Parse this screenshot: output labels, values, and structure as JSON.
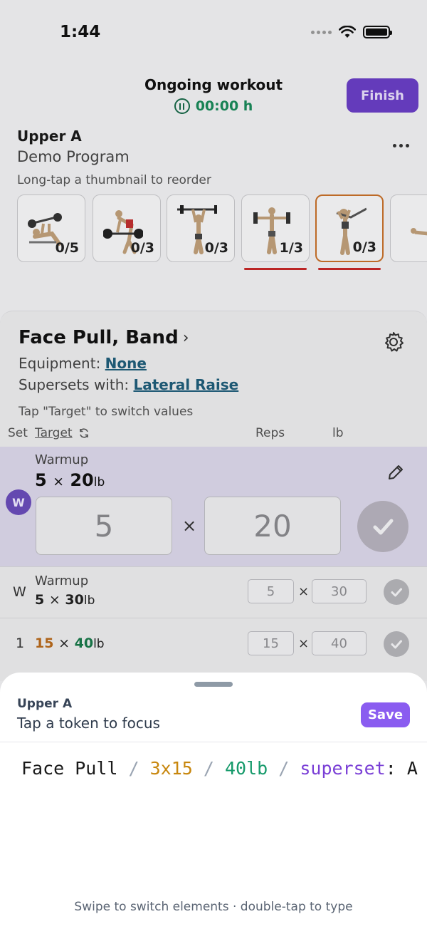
{
  "status": {
    "time": "1:44"
  },
  "header": {
    "title": "Ongoing workout",
    "timer": "00:00 h",
    "finish_label": "Finish"
  },
  "workout": {
    "name": "Upper A",
    "program": "Demo Program",
    "reorder_hint": "Long-tap a thumbnail to reorder"
  },
  "thumbnails": [
    {
      "count": "0/5",
      "active": false,
      "underline": false
    },
    {
      "count": "0/3",
      "active": false,
      "underline": false
    },
    {
      "count": "0/3",
      "active": false,
      "underline": false
    },
    {
      "count": "1/3",
      "active": false,
      "underline": true
    },
    {
      "count": "0/3",
      "active": true,
      "underline": true
    },
    {
      "count": "",
      "active": false,
      "underline": false
    }
  ],
  "exercise": {
    "title": "Face Pull, Band",
    "equipment_label": "Equipment: ",
    "equipment_value": "None",
    "superset_label": "Supersets with: ",
    "superset_value": "Lateral Raise",
    "switch_hint": "Tap \"Target\" to switch values",
    "columns": {
      "set": "Set",
      "target": "Target",
      "reps": "Reps",
      "lb": "lb"
    }
  },
  "active_set": {
    "badge": "W",
    "label": "Warmup",
    "reps": "5",
    "x": "×",
    "weight": "20",
    "unit": "lb",
    "reps_input": "5",
    "weight_input": "20"
  },
  "sets": [
    {
      "setno": "W",
      "label": "Warmup",
      "reps": "5",
      "x": "×",
      "weight": "30",
      "unit": "lb",
      "reps_input": "5",
      "weight_input": "30"
    },
    {
      "setno": "1",
      "label": "",
      "reps": "15",
      "x": "×",
      "weight": "40",
      "unit": "lb",
      "reps_input": "15",
      "weight_input": "40"
    }
  ],
  "sheet": {
    "title": "Upper A",
    "subtitle": "Tap a token to focus",
    "save_label": "Save",
    "tokens": {
      "name": "Face Pull",
      "sep": " / ",
      "sets": "3x15",
      "weight": "40lb",
      "key": "superset",
      "colon": ": ",
      "value": "A"
    },
    "footer": "Swipe to switch elements · double-tap to type"
  },
  "colors": {
    "accent": "#6a3fc6",
    "save": "#8a5cf0",
    "timer": "#1a8a5a",
    "link": "#1f5d7a",
    "active_thumb_border": "#c8702a",
    "underline_red": "#c62828",
    "token_sets": "#c8870e",
    "token_weight": "#169a6b",
    "token_key": "#7a3fd6"
  }
}
